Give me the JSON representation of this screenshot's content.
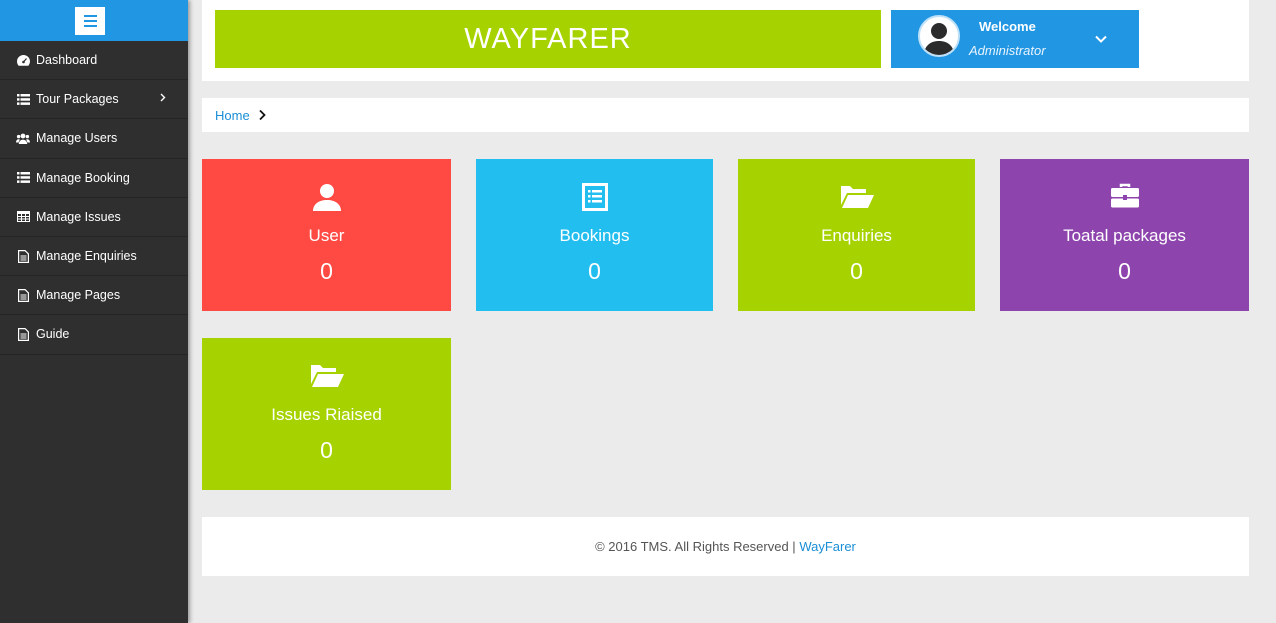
{
  "app": {
    "brand": "WAYFARER"
  },
  "user": {
    "welcome": "Welcome",
    "role": "Administrator"
  },
  "sidebar": {
    "items": [
      {
        "label": "Dashboard",
        "icon": "dashboard-icon"
      },
      {
        "label": "Tour Packages",
        "icon": "list-icon",
        "has_submenu": true
      },
      {
        "label": "Manage Users",
        "icon": "users-icon"
      },
      {
        "label": "Manage Booking",
        "icon": "list-icon"
      },
      {
        "label": "Manage Issues",
        "icon": "table-icon"
      },
      {
        "label": "Manage Enquiries",
        "icon": "file-icon"
      },
      {
        "label": "Manage Pages",
        "icon": "file-icon"
      },
      {
        "label": "Guide",
        "icon": "file-icon"
      }
    ]
  },
  "breadcrumb": {
    "home": "Home"
  },
  "cards": [
    {
      "label": "User",
      "value": "0",
      "icon": "user-icon",
      "color": "#ff4a43"
    },
    {
      "label": "Bookings",
      "value": "0",
      "icon": "list-box-icon",
      "color": "#22beef"
    },
    {
      "label": "Enquiries",
      "value": "0",
      "icon": "folder-open-icon",
      "color": "#a6d300"
    },
    {
      "label": "Toatal packages",
      "value": "0",
      "icon": "briefcase-icon",
      "color": "#8e44ad"
    },
    {
      "label": "Issues Riaised",
      "value": "0",
      "icon": "folder-open-icon",
      "color": "#a6d300"
    }
  ],
  "footer": {
    "text": "© 2016 TMS. All Rights Reserved | ",
    "link": "WayFarer"
  },
  "colors": {
    "accent": "#2196e3",
    "sidebar": "#2f2f2f",
    "brand": "#a6d300"
  }
}
